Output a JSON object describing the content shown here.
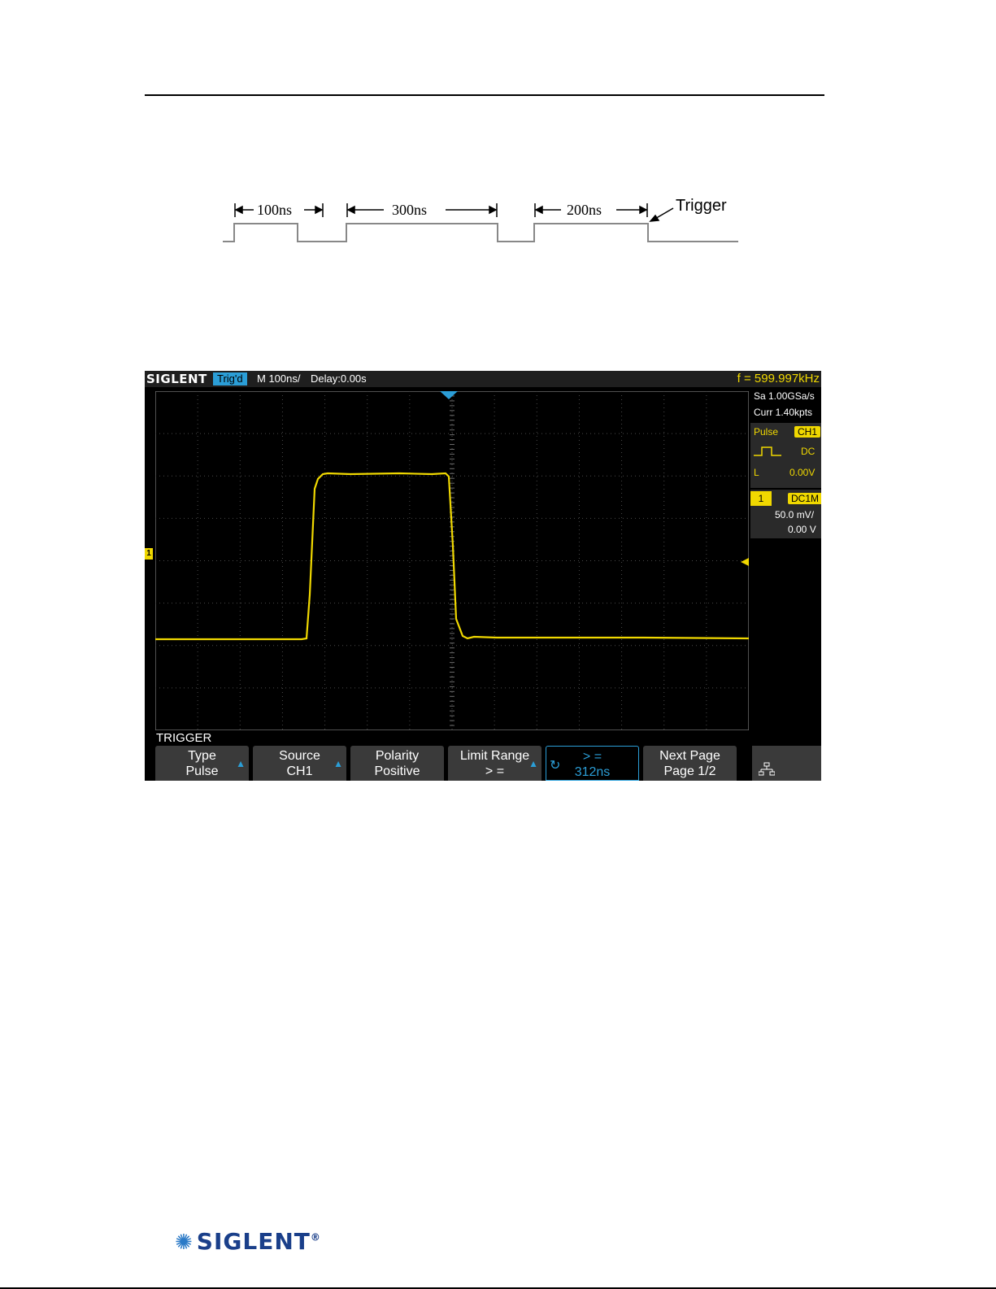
{
  "diagram": {
    "widths": [
      "100ns",
      "300ns",
      "200ns"
    ],
    "trigger_label": "Trigger"
  },
  "scope": {
    "brand": "SIGLENT",
    "trigger_state": "Trig'd",
    "timebase": "M 100ns/",
    "delay": "Delay:0.00s",
    "frequency": "f = 599.997kHz",
    "side_panel": {
      "sample_rate": "Sa 1.00GSa/s",
      "memory": "Curr 1.40kpts",
      "trigger_type": "Pulse",
      "trigger_source": "CH1",
      "coupling": "DC",
      "level_label": "L",
      "level_value": "0.00V",
      "channel_number": "1",
      "channel_coupling": "DC1M",
      "volts_per_div": "50.0 mV/",
      "offset": "0.00 V"
    },
    "menu_title": "TRIGGER",
    "softkeys": [
      {
        "label": "Type",
        "value": "Pulse"
      },
      {
        "label": "Source",
        "value": "CH1"
      },
      {
        "label": "Polarity",
        "value": "Positive"
      },
      {
        "label": "Limit Range",
        "value": "> ="
      },
      {
        "label": "> =",
        "value": "312ns"
      },
      {
        "label": "Next Page",
        "value": "Page 1/2"
      }
    ],
    "colors": {
      "trace": "#f0d800",
      "accent": "#2b9ed7",
      "grid": "#5a5a5a"
    }
  },
  "footer": {
    "logo_text": "SIGLENT",
    "registered": "®"
  }
}
